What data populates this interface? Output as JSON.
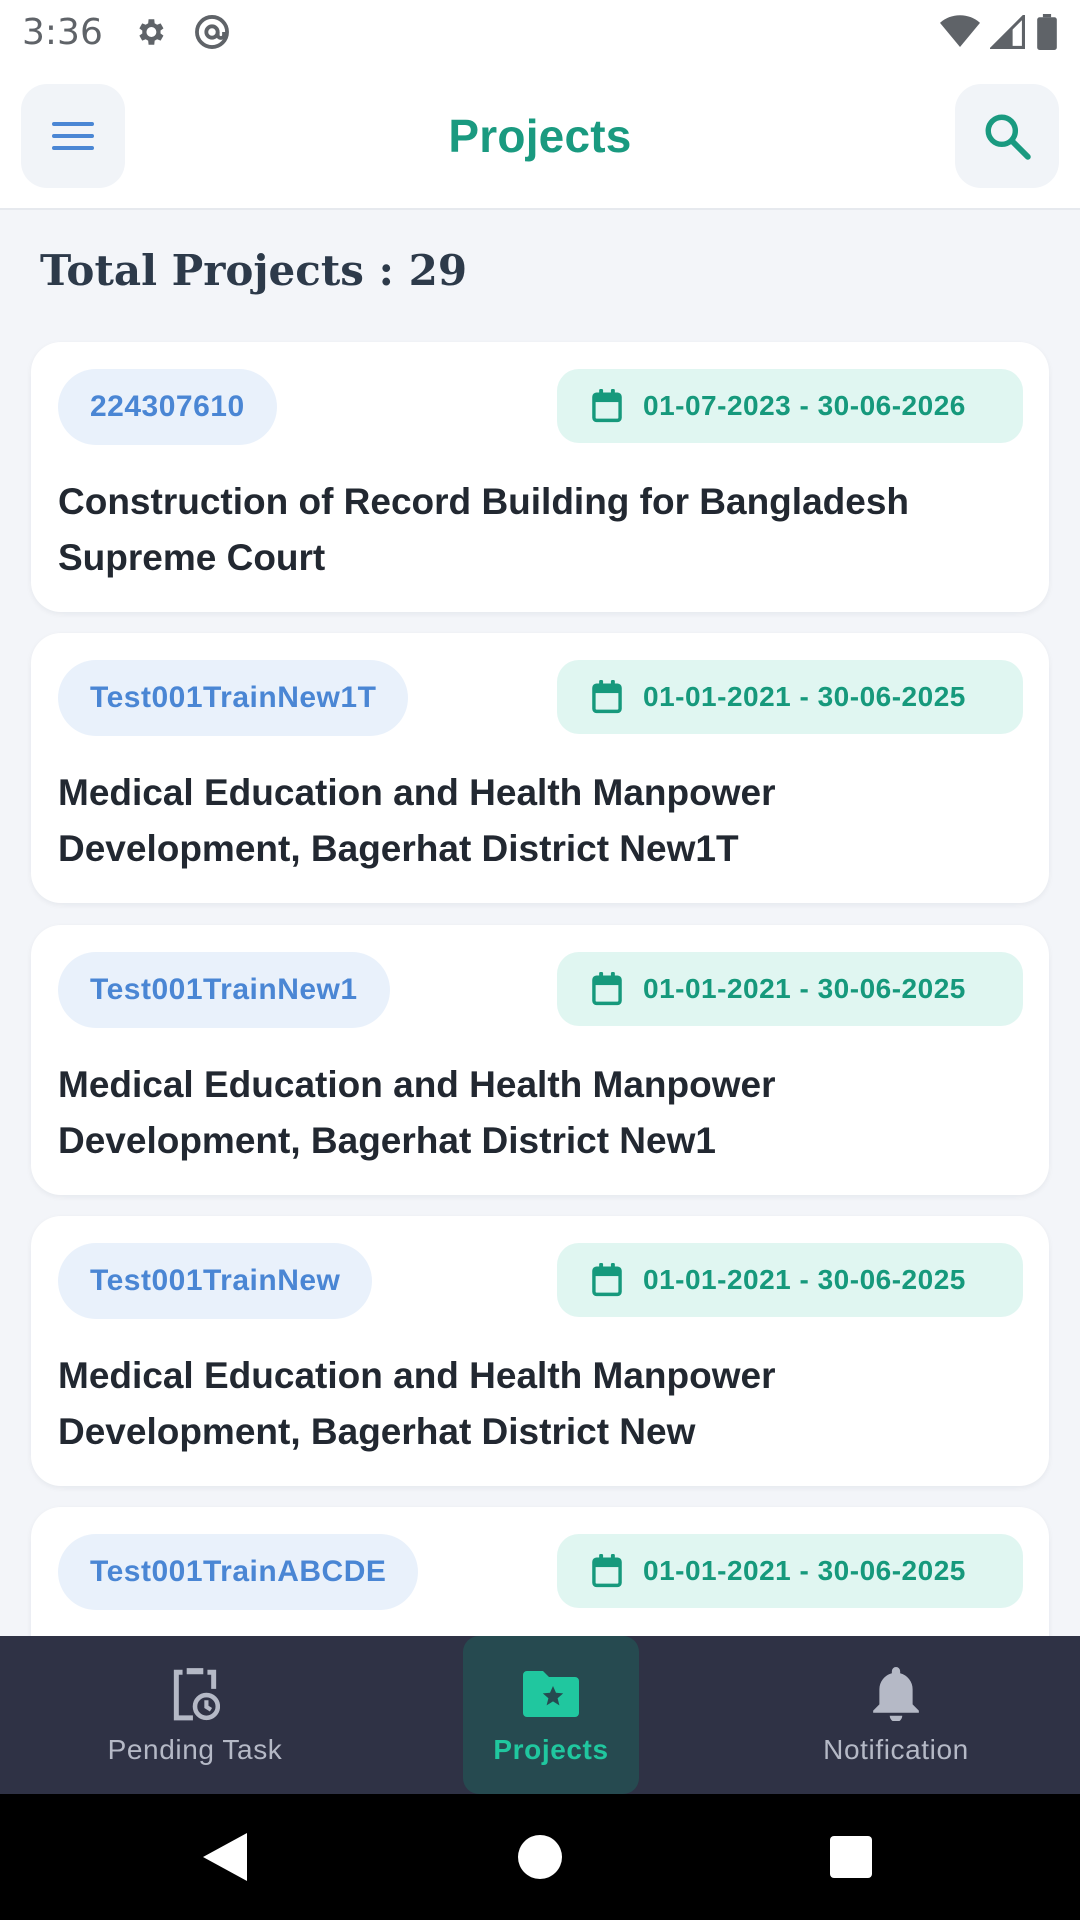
{
  "status_bar": {
    "time": "3:36",
    "icons": [
      "gear-icon",
      "at-sign-icon",
      "wifi-icon",
      "signal-icon",
      "battery-icon"
    ]
  },
  "app_bar": {
    "title": "Projects",
    "menu_icon": "hamburger-menu-icon",
    "search_icon": "search-icon"
  },
  "summary": {
    "total_label": "Total Projects : 29"
  },
  "projects": [
    {
      "code": "224307610",
      "date_range": "01-07-2023 - 30-06-2026",
      "title": "Construction of Record Building for Bangladesh Supreme Court"
    },
    {
      "code": "Test001TrainNew1T",
      "date_range": "01-01-2021 - 30-06-2025",
      "title": "Medical Education and Health Manpower Development, Bagerhat District New1T"
    },
    {
      "code": "Test001TrainNew1",
      "date_range": "01-01-2021 - 30-06-2025",
      "title": "Medical Education and Health Manpower Development, Bagerhat District New1"
    },
    {
      "code": "Test001TrainNew",
      "date_range": "01-01-2021 - 30-06-2025",
      "title": "Medical Education and Health Manpower Development, Bagerhat District New"
    },
    {
      "code": "Test001TrainABCDE",
      "date_range": "01-01-2021 - 30-06-2025",
      "title": ""
    }
  ],
  "bottom_nav": {
    "items": [
      {
        "label": "Pending Task",
        "icon": "clipboard-clock-icon",
        "active": false
      },
      {
        "label": "Projects",
        "icon": "folder-star-icon",
        "active": true
      },
      {
        "label": "Notification",
        "icon": "bell-icon",
        "active": false
      }
    ]
  },
  "colors": {
    "accent": "#1a9a80",
    "code_pill_bg": "#e9f1fb",
    "code_pill_text": "#4a86d4",
    "date_pill_bg": "#e0f6f1",
    "nav_bg": "#2f3245",
    "nav_active_bg": "#264a50",
    "nav_active_text": "#20c79f"
  }
}
